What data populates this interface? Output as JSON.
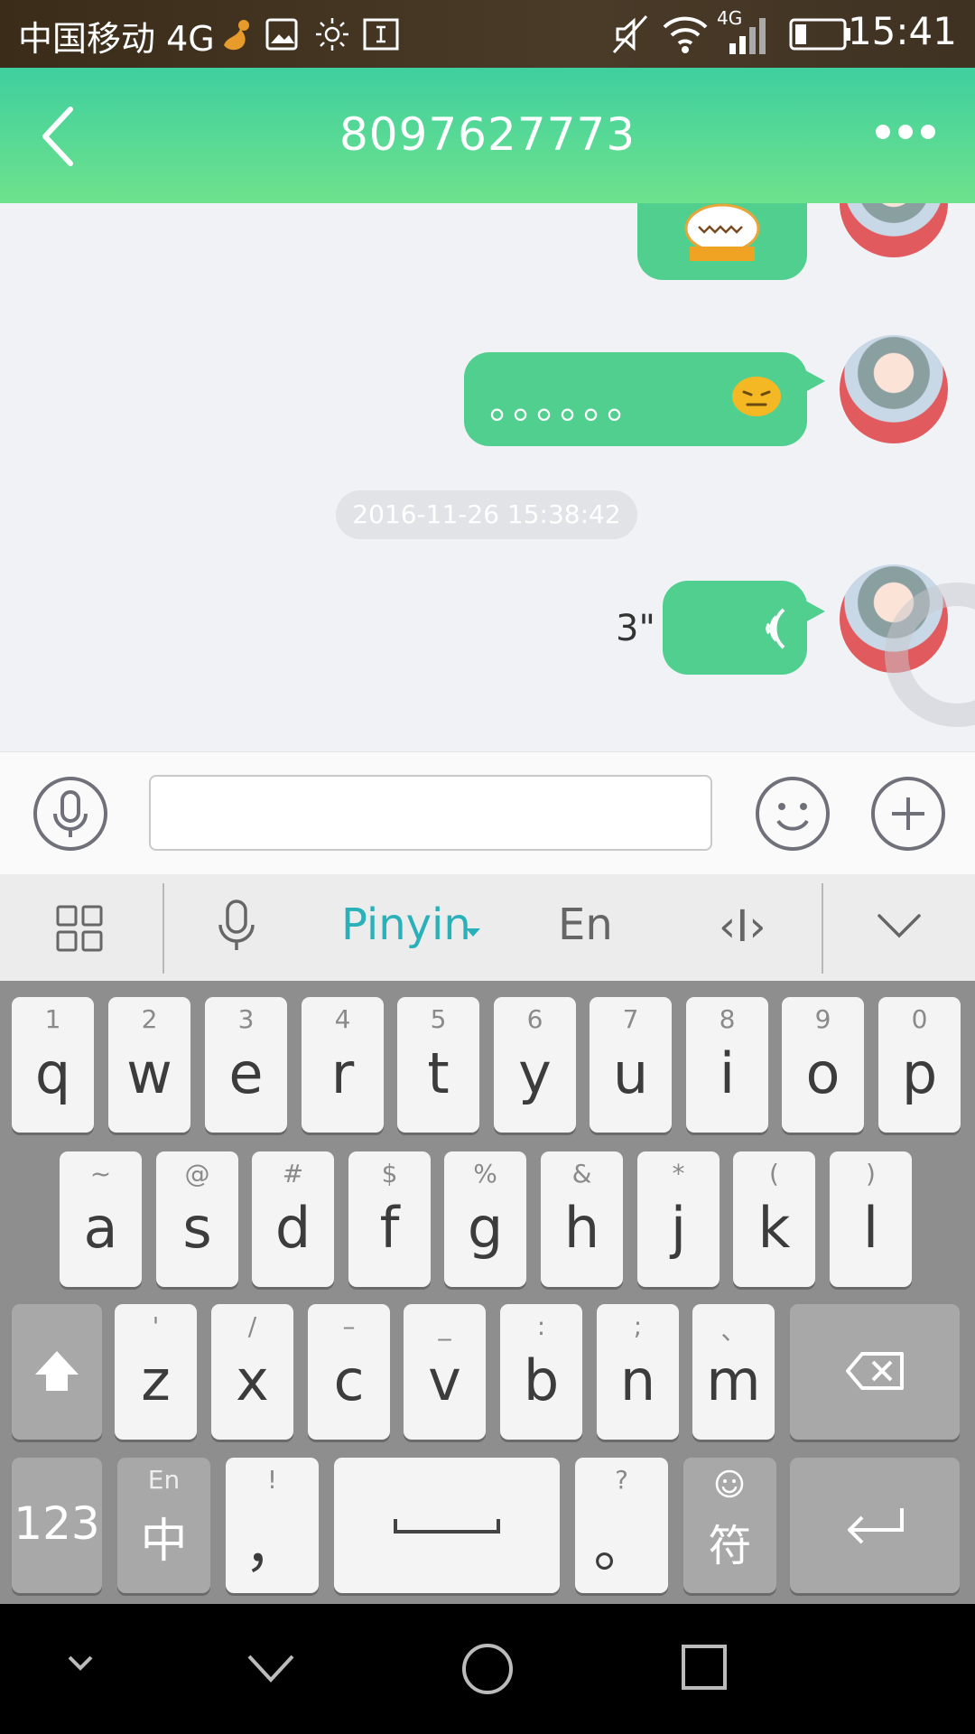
{
  "status_bar": {
    "carrier": "中国移动 4G",
    "network_label": "4G",
    "time": "15:41"
  },
  "header": {
    "title": "8097627773",
    "back_icon": "chevron-left-icon",
    "more_icon": "more-dots-icon"
  },
  "chat": {
    "messages": [
      {
        "type": "sticker",
        "sender": "me"
      },
      {
        "type": "text",
        "sender": "me",
        "text": "。。。。。。",
        "emoji": "sleepy-face-emoji"
      },
      {
        "type": "timestamp",
        "text": "2016-11-26 15:38:42"
      },
      {
        "type": "voice",
        "sender": "me",
        "duration": "3\""
      }
    ]
  },
  "input_bar": {
    "voice_icon": "microphone-icon",
    "input_value": "",
    "emoji_icon": "smiley-icon",
    "plus_icon": "plus-circle-icon"
  },
  "ime_toolbar": {
    "mode_pinyin": "Pinyin",
    "mode_en": "En",
    "cursor_label": "‹I›"
  },
  "keyboard": {
    "row1": [
      {
        "main": "q",
        "sub": "1"
      },
      {
        "main": "w",
        "sub": "2"
      },
      {
        "main": "e",
        "sub": "3"
      },
      {
        "main": "r",
        "sub": "4"
      },
      {
        "main": "t",
        "sub": "5"
      },
      {
        "main": "y",
        "sub": "6"
      },
      {
        "main": "u",
        "sub": "7"
      },
      {
        "main": "i",
        "sub": "8"
      },
      {
        "main": "o",
        "sub": "9"
      },
      {
        "main": "p",
        "sub": "0"
      }
    ],
    "row2": [
      {
        "main": "a",
        "sub": "~"
      },
      {
        "main": "s",
        "sub": "@"
      },
      {
        "main": "d",
        "sub": "#"
      },
      {
        "main": "f",
        "sub": "$"
      },
      {
        "main": "g",
        "sub": "%"
      },
      {
        "main": "h",
        "sub": "&"
      },
      {
        "main": "j",
        "sub": "*"
      },
      {
        "main": "k",
        "sub": "("
      },
      {
        "main": "l",
        "sub": ")"
      }
    ],
    "row3": [
      {
        "main": "z",
        "sub": "'"
      },
      {
        "main": "x",
        "sub": "/"
      },
      {
        "main": "c",
        "sub": "–"
      },
      {
        "main": "v",
        "sub": "_"
      },
      {
        "main": "b",
        "sub": ":"
      },
      {
        "main": "n",
        "sub": ";"
      },
      {
        "main": "m",
        "sub": "、"
      }
    ],
    "num_key": "123",
    "lang_key_sub": "En",
    "lang_key_main": "中",
    "comma_sub": "!",
    "comma_main": "，",
    "period_sub": "?",
    "period_main": "。",
    "symbol_key": "符"
  },
  "colors": {
    "header_start": "#3fcf9f",
    "header_end": "#6ee28c",
    "bubble": "#51cf8f",
    "accent_ime": "#2ab0b8"
  }
}
